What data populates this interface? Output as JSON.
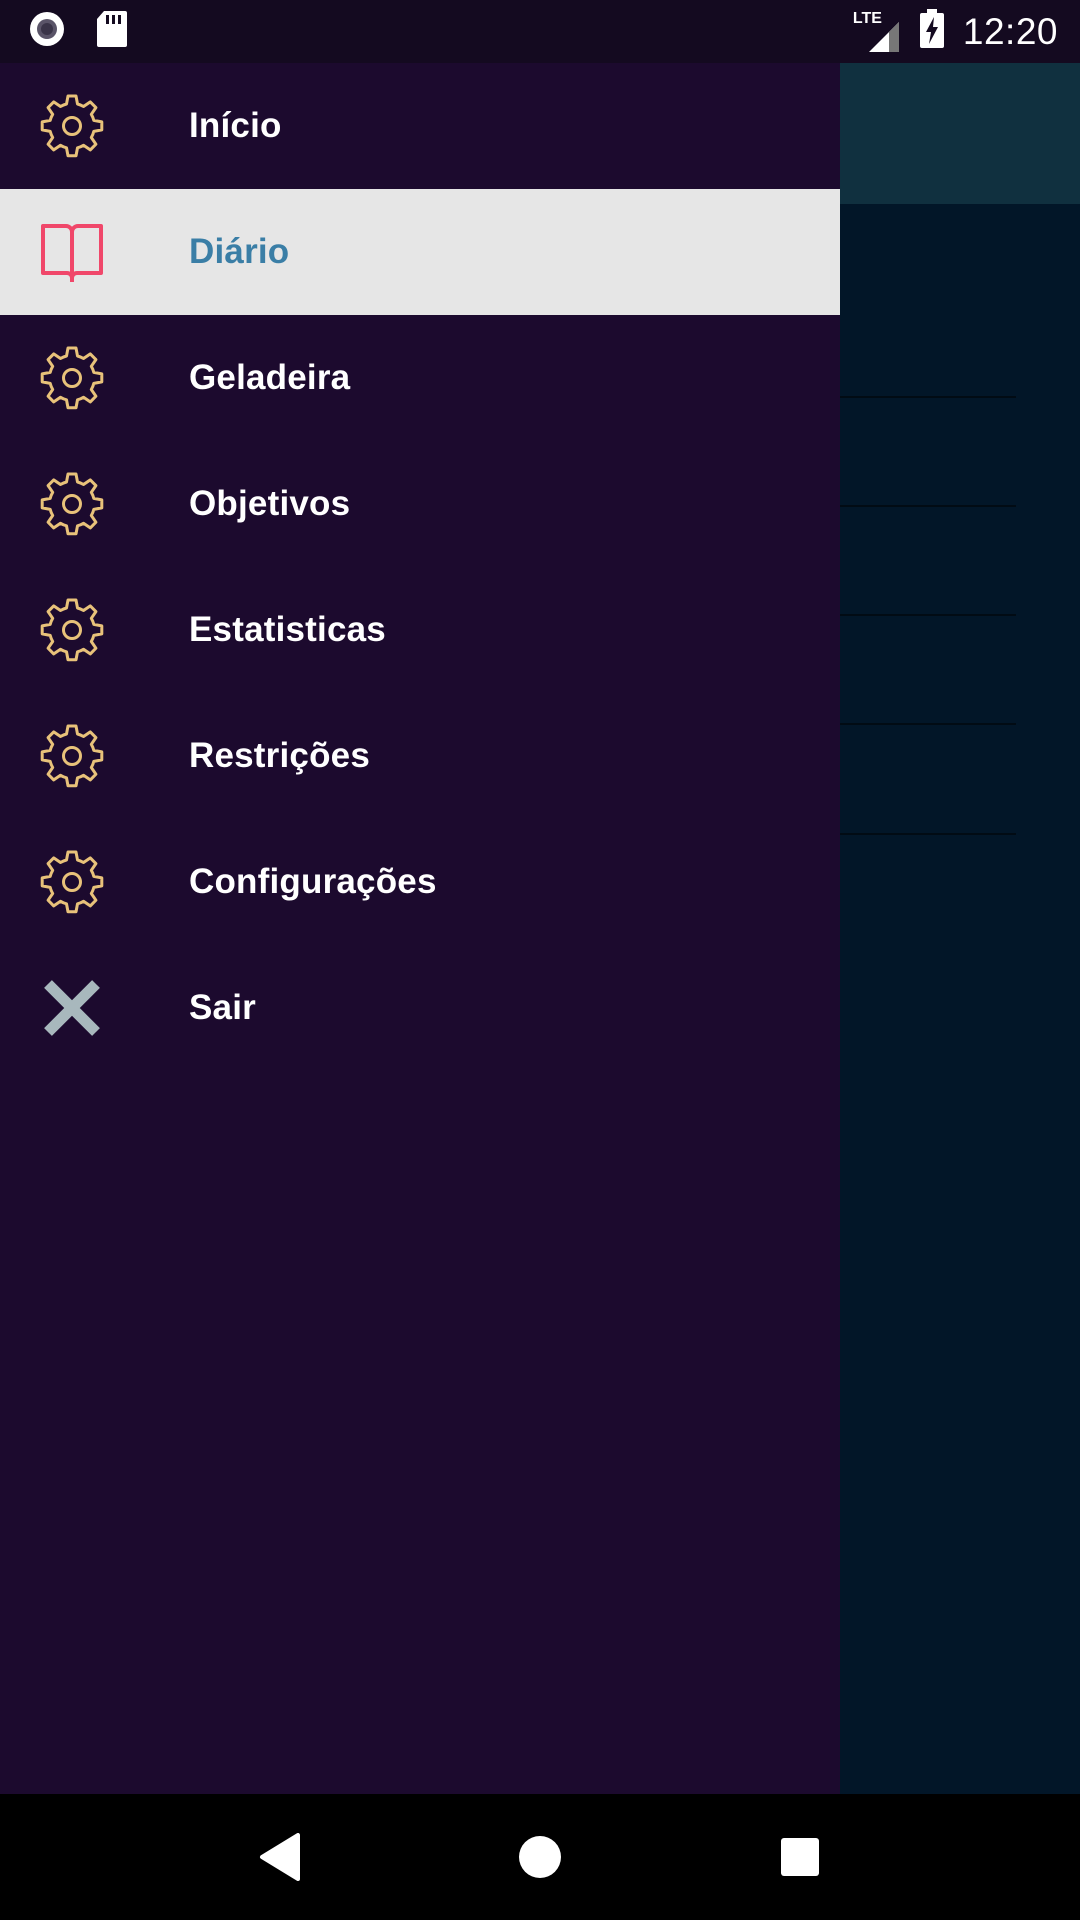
{
  "status_bar": {
    "time": "12:20",
    "network_label": "LTE",
    "icons": [
      "record-icon",
      "sd-card-icon",
      "signal-icon",
      "battery-charging-icon"
    ]
  },
  "drawer": {
    "items": [
      {
        "label": "Início",
        "icon": "gear-icon",
        "active": false
      },
      {
        "label": "Diário",
        "icon": "book-icon",
        "active": true
      },
      {
        "label": "Geladeira",
        "icon": "gear-icon",
        "active": false
      },
      {
        "label": "Objetivos",
        "icon": "gear-icon",
        "active": false
      },
      {
        "label": "Estatisticas",
        "icon": "gear-icon",
        "active": false
      },
      {
        "label": "Restrições",
        "icon": "gear-icon",
        "active": false
      },
      {
        "label": "Configurações",
        "icon": "gear-icon",
        "active": false
      },
      {
        "label": "Sair",
        "icon": "close-icon",
        "active": false
      }
    ]
  },
  "colors": {
    "drawer_bg": "#1c0a2e",
    "active_bg": "#e6e6e6",
    "active_text": "#3a7ea6",
    "gear_icon": "#e8c27a",
    "book_icon": "#f0476a",
    "close_icon": "#a8b8bd"
  },
  "nav_bar": {
    "buttons": [
      "back-icon",
      "home-icon",
      "recents-icon"
    ]
  }
}
